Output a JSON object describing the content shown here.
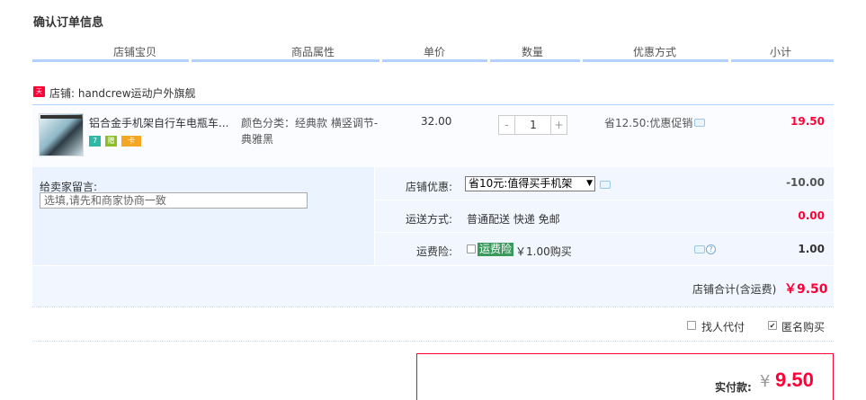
{
  "page": {
    "title": "确认订单信息"
  },
  "columns": [
    "店铺宝贝",
    "商品属性",
    "单价",
    "数量",
    "优惠方式",
    "小计"
  ],
  "shop": {
    "badge": "天猫",
    "name": "店铺: handcrew运动户外旗舰"
  },
  "item": {
    "title": "铝合金手机架自行车电瓶车...",
    "badges": [
      "7",
      "赠",
      "卡"
    ],
    "attribute": "颜色分类：经典款 横竖调节-典雅黑",
    "price": "32.00",
    "qty_minus": "-",
    "qty_value": "1",
    "qty_plus": "+",
    "promo": "省12.50:优惠促销",
    "subtotal": "19.50"
  },
  "message": {
    "label": "给卖家留言:",
    "placeholder": "选填,请先和商家协商一致"
  },
  "shop_discount": {
    "label": "店铺优惠:",
    "selected": "省10元:值得买手机架",
    "amount": "-10.00"
  },
  "shipping": {
    "label": "运送方式:",
    "value": "普通配送 快递 免邮",
    "amount": "0.00"
  },
  "insurance": {
    "label": "运费险:",
    "badge": "运费险",
    "price": "￥1.00购买",
    "amount": "1.00",
    "checked": false
  },
  "shop_total": {
    "label": "店铺合计(含运费)",
    "value": "￥9.50"
  },
  "options": {
    "proxy_pay": "找人代付",
    "proxy_checked": false,
    "anonymous": "匿名购买",
    "anonymous_checked": true
  },
  "payment": {
    "label": "实付款:",
    "currency": "¥",
    "value": "9.50"
  },
  "colors": {
    "accent_red": "#ff0036",
    "header_line": "#b2d1ff",
    "panel_bg": "#f2f7ff"
  }
}
